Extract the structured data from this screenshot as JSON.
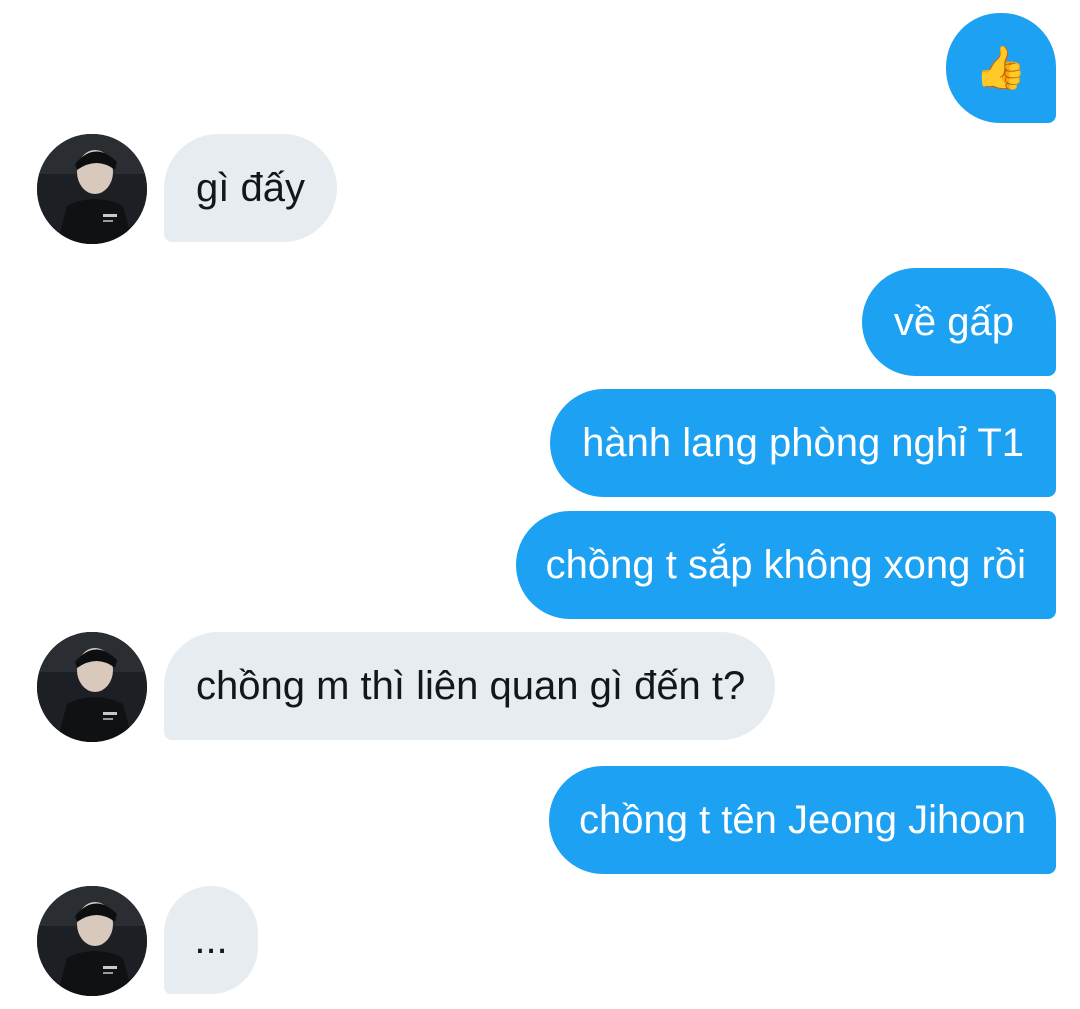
{
  "thread": {
    "emoji": {
      "icon": "thumbs-up-icon",
      "glyph": "👍"
    },
    "messages": [
      {
        "side": "in",
        "text": "gì đấy"
      },
      {
        "side": "out",
        "text": "về gấp"
      },
      {
        "side": "out",
        "text": "hành lang phòng nghỉ T1"
      },
      {
        "side": "out",
        "text": "chồng t sắp không xong rồi"
      },
      {
        "side": "in",
        "text": "chồng m thì liên quan gì đến t?"
      },
      {
        "side": "out",
        "text": "chồng t tên Jeong Jihoon"
      },
      {
        "side": "in",
        "text": "..."
      }
    ]
  },
  "colors": {
    "outgoing_bubble": "#1da1f2",
    "incoming_bubble": "#e6ecf0",
    "outgoing_text": "#ffffff",
    "incoming_text": "#14171a"
  }
}
